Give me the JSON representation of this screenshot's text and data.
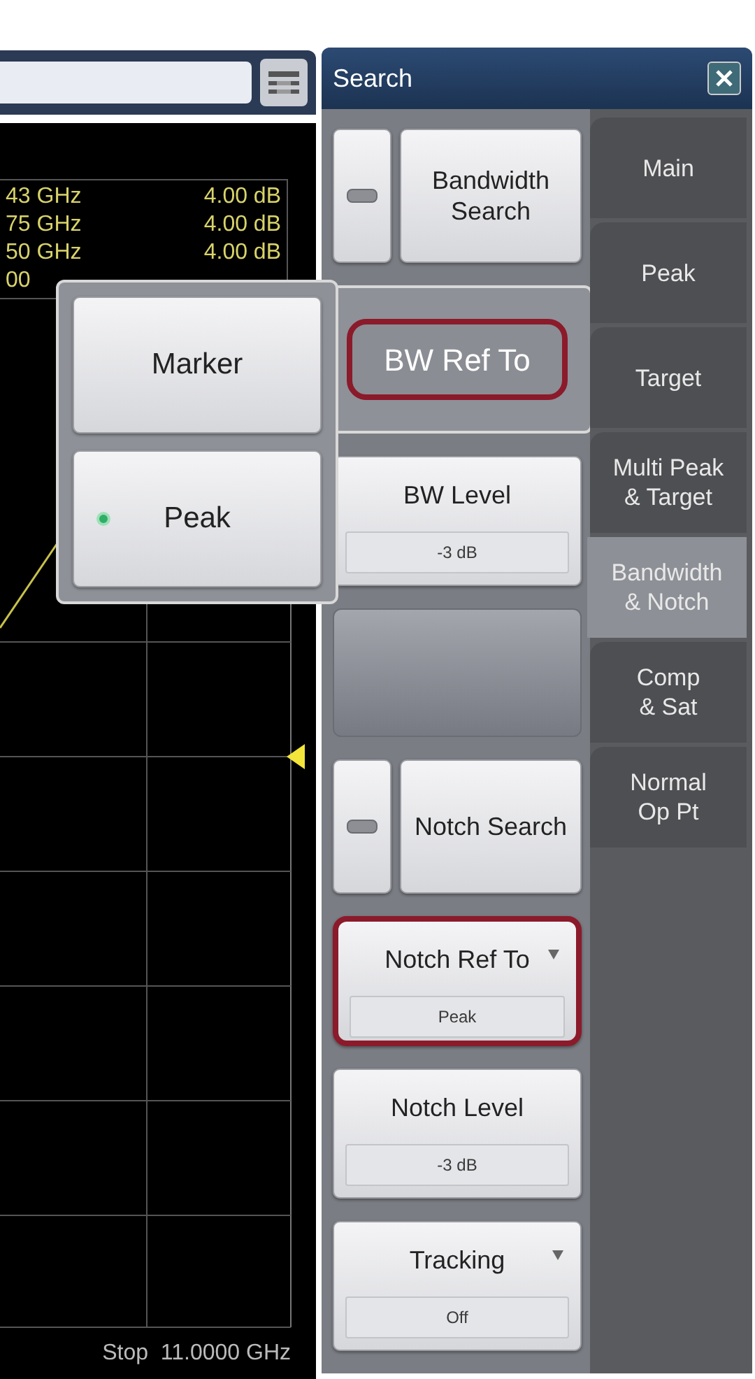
{
  "marker_table": [
    {
      "frequency": "43 GHz",
      "value": "4.00 dB"
    },
    {
      "frequency": "75 GHz",
      "value": "4.00 dB"
    },
    {
      "frequency": "50 GHz",
      "value": "4.00 dB"
    },
    {
      "frequency": "00"
    }
  ],
  "stop_label": "Stop  11.0000 GHz",
  "popup": {
    "options": [
      {
        "label": "Marker",
        "selected": false
      },
      {
        "label": "Peak",
        "selected": true
      }
    ]
  },
  "panel": {
    "title": "Search",
    "softkeys": [
      {
        "kind": "toggle",
        "label": "Bandwidth Search",
        "on": false,
        "highlighted": false
      },
      {
        "kind": "open_menu",
        "label": "BW Ref To",
        "highlighted": true
      },
      {
        "kind": "value",
        "label": "BW Level",
        "value": "-3 dB",
        "highlighted": false
      },
      {
        "kind": "blank"
      },
      {
        "kind": "toggle",
        "label": "Notch Search",
        "on": false,
        "highlighted": false
      },
      {
        "kind": "dropdown",
        "label": "Notch Ref To",
        "value": "Peak",
        "highlighted": true
      },
      {
        "kind": "value",
        "label": "Notch Level",
        "value": "-3 dB",
        "highlighted": false
      },
      {
        "kind": "dropdown",
        "label": "Tracking",
        "value": "Off",
        "highlighted": false
      }
    ],
    "tabs": [
      {
        "label": "Main",
        "selected": false
      },
      {
        "label": "Peak",
        "selected": false
      },
      {
        "label": "Target",
        "selected": false
      },
      {
        "label": "Multi Peak\n& Target",
        "selected": false
      },
      {
        "label": "Bandwidth\n& Notch",
        "selected": true
      },
      {
        "label": "Comp\n& Sat",
        "selected": false
      },
      {
        "label": "Normal\nOp Pt",
        "selected": false
      }
    ]
  }
}
